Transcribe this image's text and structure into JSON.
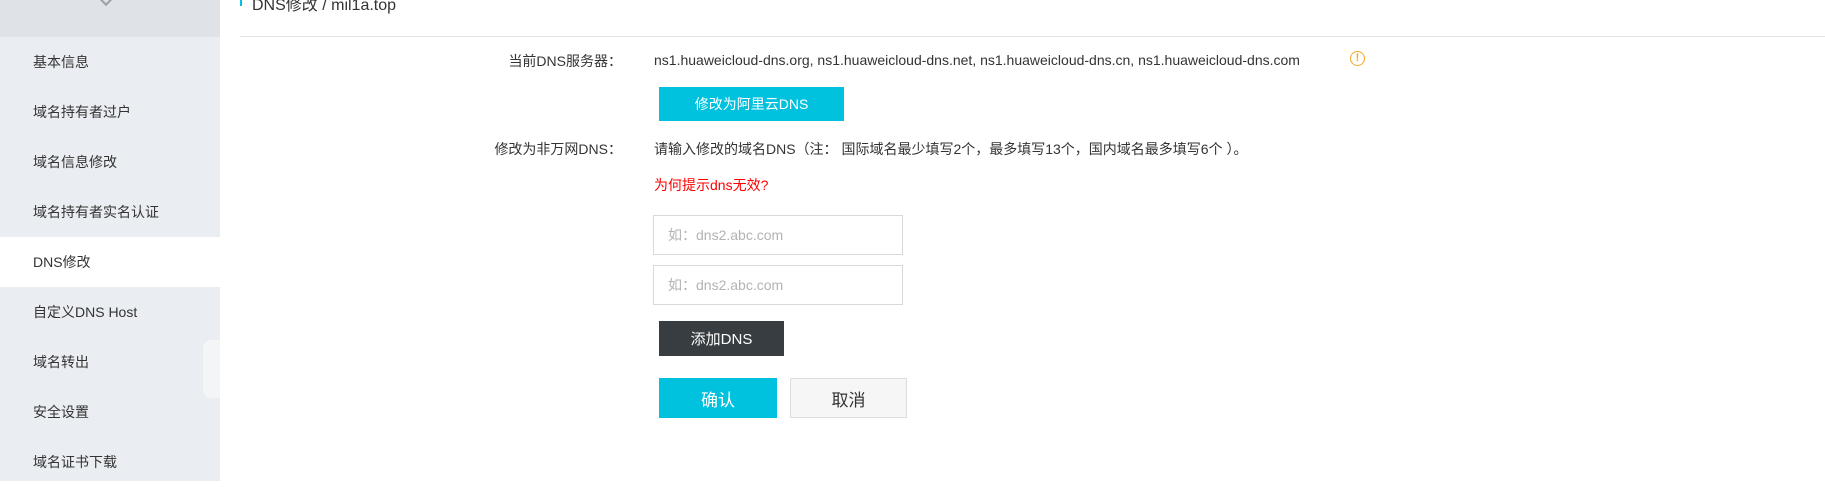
{
  "breadcrumb": "DNS修改 / mil1a.top",
  "sidebar": {
    "items": [
      {
        "label": "基本信息"
      },
      {
        "label": "域名持有者过户"
      },
      {
        "label": "域名信息修改"
      },
      {
        "label": "域名持有者实名认证"
      },
      {
        "label": "DNS修改"
      },
      {
        "label": "自定义DNS Host"
      },
      {
        "label": "域名转出"
      },
      {
        "label": "安全设置"
      },
      {
        "label": "域名证书下载"
      }
    ]
  },
  "form": {
    "current_dns_label": "当前DNS服务器：",
    "current_dns_value": "ns1.huaweicloud-dns.org, ns1.huaweicloud-dns.net, ns1.huaweicloud-dns.cn, ns1.huaweicloud-dns.com",
    "change_to_aliyun_button": "修改为阿里云DNS",
    "custom_dns_label": "修改为非万网DNS：",
    "custom_dns_hint": "请输入修改的域名DNS（注： 国际域名最少填写2个，最多填写13个，国内域名最多填写6个 ）。",
    "why_invalid_link": "为何提示dns无效?",
    "dns_inputs": [
      {
        "value": "",
        "placeholder": "如：dns2.abc.com"
      },
      {
        "value": "",
        "placeholder": "如：dns2.abc.com"
      }
    ],
    "add_dns_button": "添加DNS",
    "confirm_button": "确认",
    "cancel_button": "取消"
  },
  "colors": {
    "accent": "#00c1de",
    "dark_button": "#373d41",
    "warning": "#f5a623",
    "link_red": "#ff0000",
    "sidebar_bg": "#eaedf1"
  },
  "icons": {
    "info": "info-circle-icon",
    "collapse": "chevron-down-icon"
  }
}
